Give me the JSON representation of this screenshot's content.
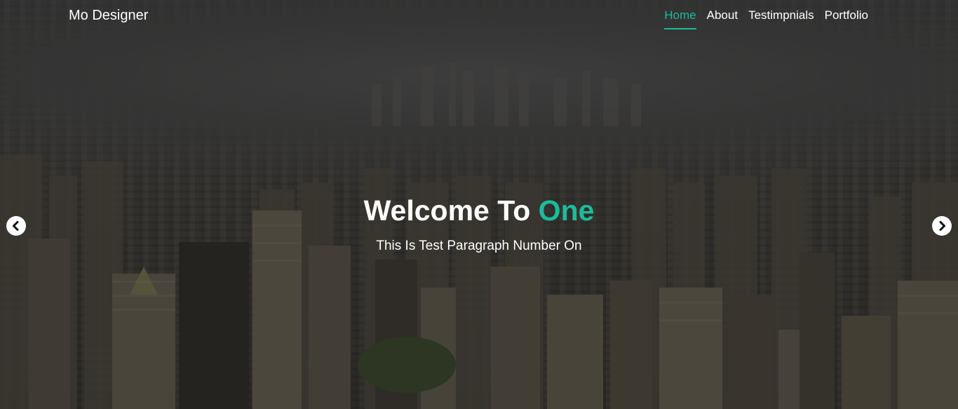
{
  "navbar": {
    "brand": "Mo Designer",
    "links": [
      {
        "label": "Home",
        "active": true
      },
      {
        "label": "About",
        "active": false
      },
      {
        "label": "Testimpnials",
        "active": false
      },
      {
        "label": "Portfolio",
        "active": false
      }
    ]
  },
  "hero": {
    "title_main": "Welcome To ",
    "title_accent": "One",
    "paragraph": "This Is Test Paragraph Number On"
  },
  "carousel": {
    "prev_icon": "chevron-left-icon",
    "next_icon": "chevron-right-icon"
  },
  "colors": {
    "accent": "#1abc9c",
    "text": "#ffffff"
  }
}
